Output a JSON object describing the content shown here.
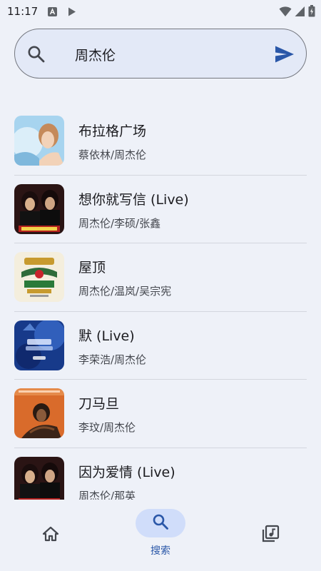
{
  "status_bar": {
    "time": "11:17",
    "icons": [
      "translate-a-icon",
      "play-store-icon",
      "wifi-icon",
      "signal-icon",
      "battery-icon"
    ]
  },
  "search": {
    "query": "周杰伦",
    "icon": "search-icon",
    "submit_icon": "send-icon"
  },
  "songs": [
    {
      "title": "布拉格广场",
      "artist": "蔡依林/周杰伦",
      "cover_color": "#9ec9e8"
    },
    {
      "title": "想你就写信 (Live)",
      "artist": "周杰伦/李硕/张鑫",
      "cover_color": "#3a1a1a"
    },
    {
      "title": "屋顶",
      "artist": "周杰伦/温岚/吴宗宪",
      "cover_color": "#f1ead8"
    },
    {
      "title": "默 (Live)",
      "artist": "李荣浩/周杰伦",
      "cover_color": "#1c3c8c"
    },
    {
      "title": "刀马旦",
      "artist": "李玟/周杰伦",
      "cover_color": "#d86a2a"
    },
    {
      "title": "因为爱情 (Live)",
      "artist": "周杰伦/那英",
      "cover_color": "#3a1a1a"
    }
  ],
  "bottom_nav": {
    "home_icon": "home-icon",
    "search_icon": "search-icon",
    "search_label": "搜索",
    "library_icon": "music-library-icon",
    "active_color": "#2a57a8"
  }
}
